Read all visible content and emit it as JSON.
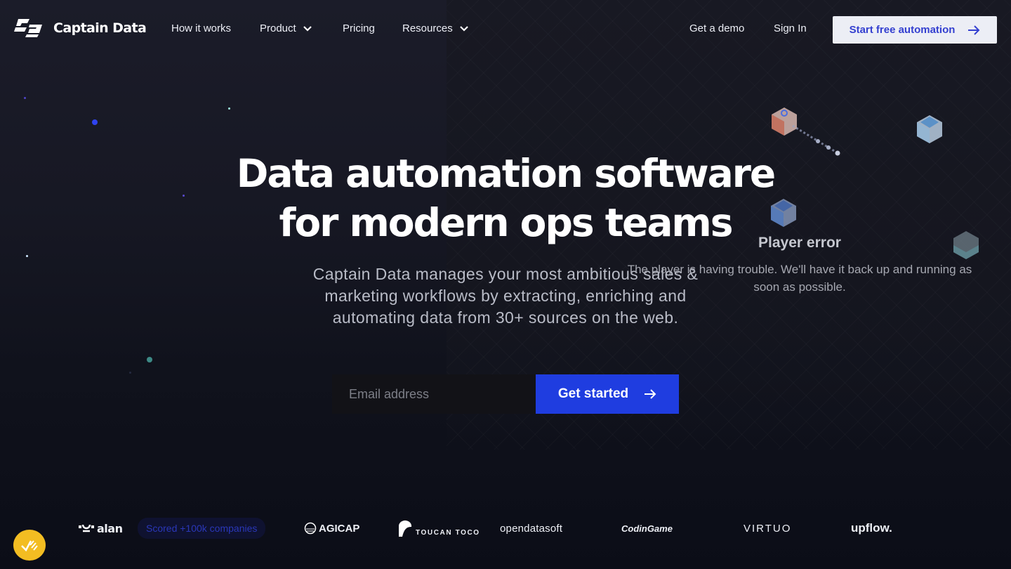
{
  "nav": {
    "brand_name": "Captain Data",
    "links": [
      {
        "label": "How it works",
        "has_dropdown": false
      },
      {
        "label": "Product",
        "has_dropdown": true
      },
      {
        "label": "Pricing",
        "has_dropdown": false
      },
      {
        "label": "Resources",
        "has_dropdown": true
      }
    ],
    "get_demo": "Get a demo",
    "sign_in": "Sign In",
    "cta": "Start free automation",
    "cta_icon": "arrow-right-icon"
  },
  "hero": {
    "title_line1": "Data automation software",
    "title_line2": "for modern ops teams",
    "subtitle": "Captain Data manages your most ambitious sales & marketing workflows by extracting, enriching and automating data from 30+ sources on the web.",
    "email_placeholder": "Email address",
    "email_value": "",
    "get_started": "Get started",
    "get_started_icon": "arrow-right-icon"
  },
  "player": {
    "error_title": "Player error",
    "error_message": "The player is having trouble. We'll have it back up and running as soon as possible."
  },
  "logos": {
    "badge": "Scored +100k companies",
    "brands": [
      "alan",
      "AGICAP",
      "TOUCAN TOCO",
      "opendatasoft",
      "CodinGame",
      "VIRTUO",
      "upflow."
    ]
  },
  "widget": {
    "icon": "checkmark-badge-icon"
  },
  "colors": {
    "accent_blue": "#1f3de0",
    "cta_text": "#3440d0",
    "widget_yellow": "#f3bd22",
    "background": "#171824"
  }
}
